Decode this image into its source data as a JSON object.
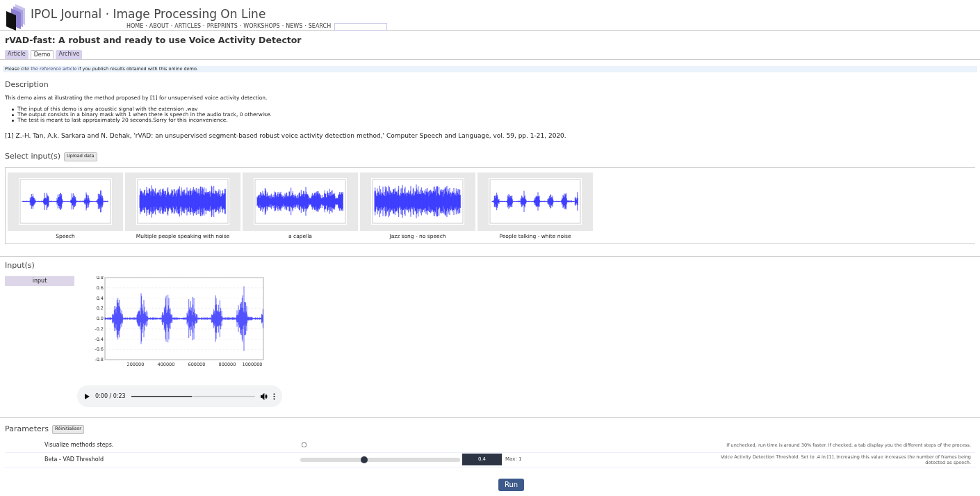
{
  "site": {
    "title": "IPOL Journal · Image Processing On Line",
    "nav": [
      "HOME",
      "ABOUT",
      "ARTICLES",
      "PREPRINTS",
      "WORKSHOPS",
      "NEWS",
      "SEARCH"
    ],
    "separator": "·"
  },
  "page_title": "rVAD-fast: A robust and ready to use Voice Activity Detector",
  "tabs": [
    {
      "label": "Article",
      "selected": false
    },
    {
      "label": "Demo",
      "selected": true
    },
    {
      "label": "Archive",
      "selected": false
    }
  ],
  "notice": {
    "before": "Please cite",
    "link": "the reference article",
    "after": "if you publish results obtained with this online demo."
  },
  "description": {
    "heading": "Description",
    "intro": "This demo aims at illustrating the method proposed by [1] for unsupervised voice activity detection.",
    "bullets": [
      "The input of this demo is any acoustic signal with the extension .wav",
      "The output consists in a binary mask with 1 when there is speech in the audio track, 0 otherwise.",
      "The test is meant to last approximately 20 seconds.Sorry for this inconvenience."
    ],
    "reference": "[1] Z.-H. Tan, A.k. Sarkara and N. Dehak, 'rVAD: an unsupervised segment-based robust voice activity detection method,' Computer Speech and Language, vol. 59, pp. 1-21, 2020."
  },
  "select_inputs": {
    "heading": "Select input(s)",
    "upload_button": "Upload data",
    "items": [
      {
        "caption": "Speech",
        "kind": "bursts"
      },
      {
        "caption": "Multiple people speaking with noise",
        "kind": "dense"
      },
      {
        "caption": "a capella",
        "kind": "mixed"
      },
      {
        "caption": "Jazz song - no speech",
        "kind": "dense"
      },
      {
        "caption": "People talking - white noise",
        "kind": "bursts"
      }
    ]
  },
  "inputs": {
    "heading": "Input(s)",
    "label": "input",
    "plot": {
      "yticks": [
        "0.8",
        "0.6",
        "0.4",
        "0.2",
        "0.0",
        "-0.2",
        "-0.4",
        "-0.6",
        "-0.8"
      ],
      "xticks": [
        "200000",
        "400000",
        "600000",
        "800000",
        "1000000"
      ]
    },
    "audio": {
      "time": "0:00 / 0:23",
      "level": 0.49
    }
  },
  "parameters": {
    "heading": "Parameters",
    "reset_button": "Réinitialiser",
    "rows": [
      {
        "kind": "checkbox",
        "label": "Visualize methods steps.",
        "checked": false,
        "help": "If unchecked, run time is around 30% faster. If checked, a tab display you the different steps of the process."
      },
      {
        "kind": "slider",
        "label": "Beta - VAD Threshold",
        "level": 0.4,
        "value": "0,4",
        "max": "Max: 1",
        "help": "Voice Activity Detection Threshold. Set to .4 in [1]. Increasing this value increases the number of frames being detected as speech."
      }
    ]
  },
  "run_button": "Run"
}
